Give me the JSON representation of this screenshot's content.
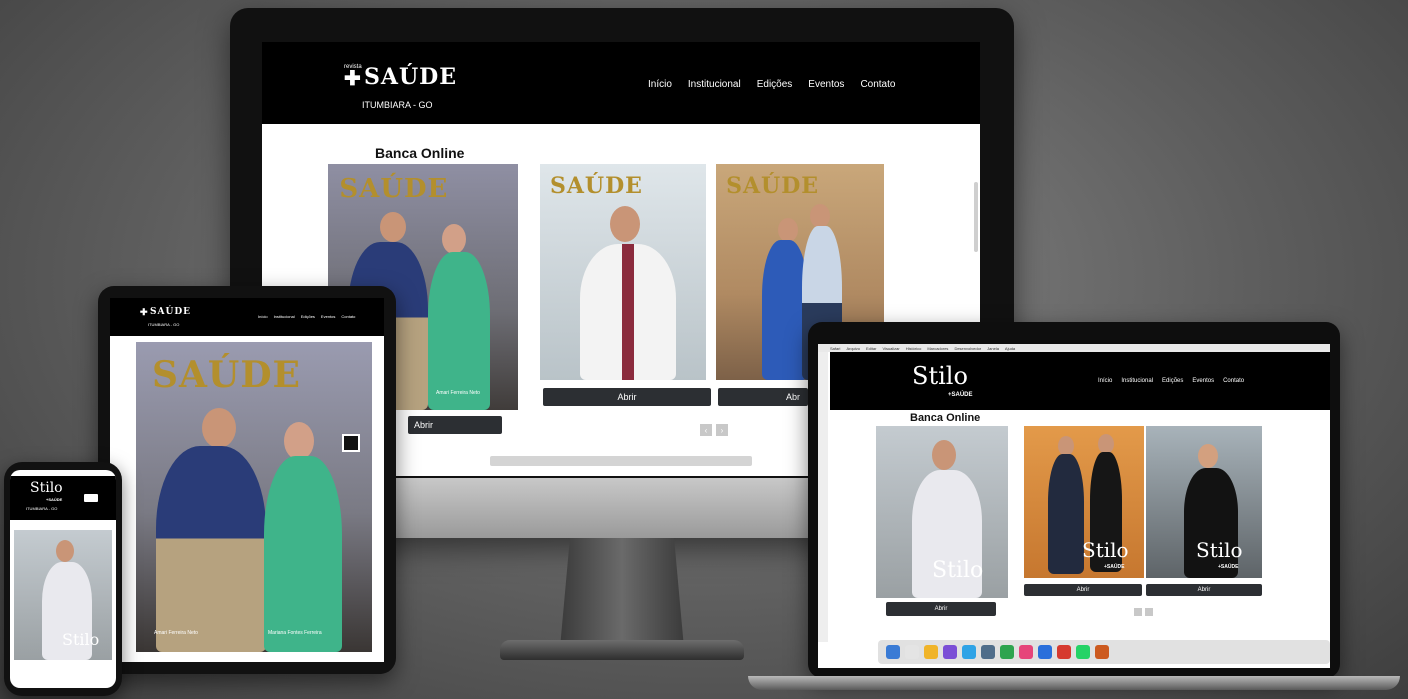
{
  "site": {
    "logo_prefix": "revista",
    "logo_name": "SAÚDE",
    "location": "ITUMBIARA - GO",
    "nav": [
      "Início",
      "Institucional",
      "Edições",
      "Eventos",
      "Contato"
    ]
  },
  "monitor": {
    "section_title": "Banca Online",
    "covers": [
      {
        "masthead": "SAÚDE",
        "caption": "Amari Ferreira Neto"
      },
      {
        "masthead": "SAÚDE",
        "caption": ""
      },
      {
        "masthead": "SAÚDE",
        "caption": ""
      }
    ],
    "open_label": "Abrir",
    "open_label_cut": "Abr"
  },
  "tablet": {
    "logo_name": "SAÚDE",
    "location": "ITUMBIARA - GO",
    "cover_masthead": "SAÚDE",
    "caption_left": "Amari Ferreira Neto",
    "caption_right": "Mariana Fontes Ferreira"
  },
  "laptop": {
    "brand": "Stilo",
    "brand_sub": "+SAÚDE",
    "nav": [
      "Início",
      "Institucional",
      "Edições",
      "Eventos",
      "Contato"
    ],
    "section_title": "Banca Online",
    "cover_brand": "Stilo",
    "cover_brand_sub": "+SAÚDE",
    "open_label": "Abrir",
    "menubar": [
      "Safari",
      "Arquivo",
      "Editar",
      "Visualizar",
      "Histórico",
      "Marcadores",
      "Desenvolvedor",
      "Janela",
      "Ajuda"
    ]
  },
  "phone": {
    "brand": "Stilo",
    "brand_sub": "+SAÚDE",
    "location": "ITUMBIARA - GO",
    "cover_brand": "Stilo"
  }
}
